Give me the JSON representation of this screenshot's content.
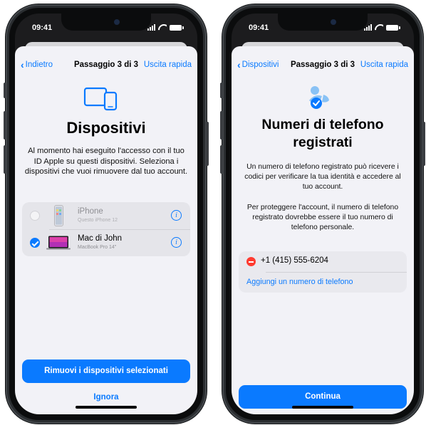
{
  "left": {
    "status": {
      "time": "09:41"
    },
    "nav": {
      "back": "Indietro",
      "title": "Passaggio 3 di 3",
      "quick_exit": "Uscita rapida"
    },
    "heading": "Dispositivi",
    "body": "Al momento hai eseguito l'accesso con il tuo ID Apple su questi dispositivi. Seleziona i dispositivi che vuoi rimuovere dal tuo account.",
    "devices": [
      {
        "name": "iPhone",
        "subtitle": "Questo iPhone 12",
        "selected": false,
        "icon": "iphone-icon"
      },
      {
        "name": "Mac di John",
        "subtitle": "MacBook Pro 14\"",
        "selected": true,
        "icon": "macbook-icon"
      }
    ],
    "primary_button": "Rimuovi i dispositivi selezionati",
    "secondary_button": "Ignora"
  },
  "right": {
    "status": {
      "time": "09:41"
    },
    "nav": {
      "back": "Dispositivi",
      "title": "Passaggio 3 di 3",
      "quick_exit": "Uscita rapida"
    },
    "heading": "Numeri di telefono registrati",
    "body1": "Un numero di telefono registrato può ricevere i codici per verificare la tua identità e accedere al tuo account.",
    "body2": "Per proteggere l'account, il numero di telefono registrato dovrebbe essere il tuo numero di telefono personale.",
    "phone_number": "+1 (415) 555-6204",
    "add_number": "Aggiungi un numero di telefono",
    "primary_button": "Continua"
  },
  "colors": {
    "accent": "#0a7aff",
    "destructive": "#ff3b30",
    "background": "#f2f2f7"
  }
}
